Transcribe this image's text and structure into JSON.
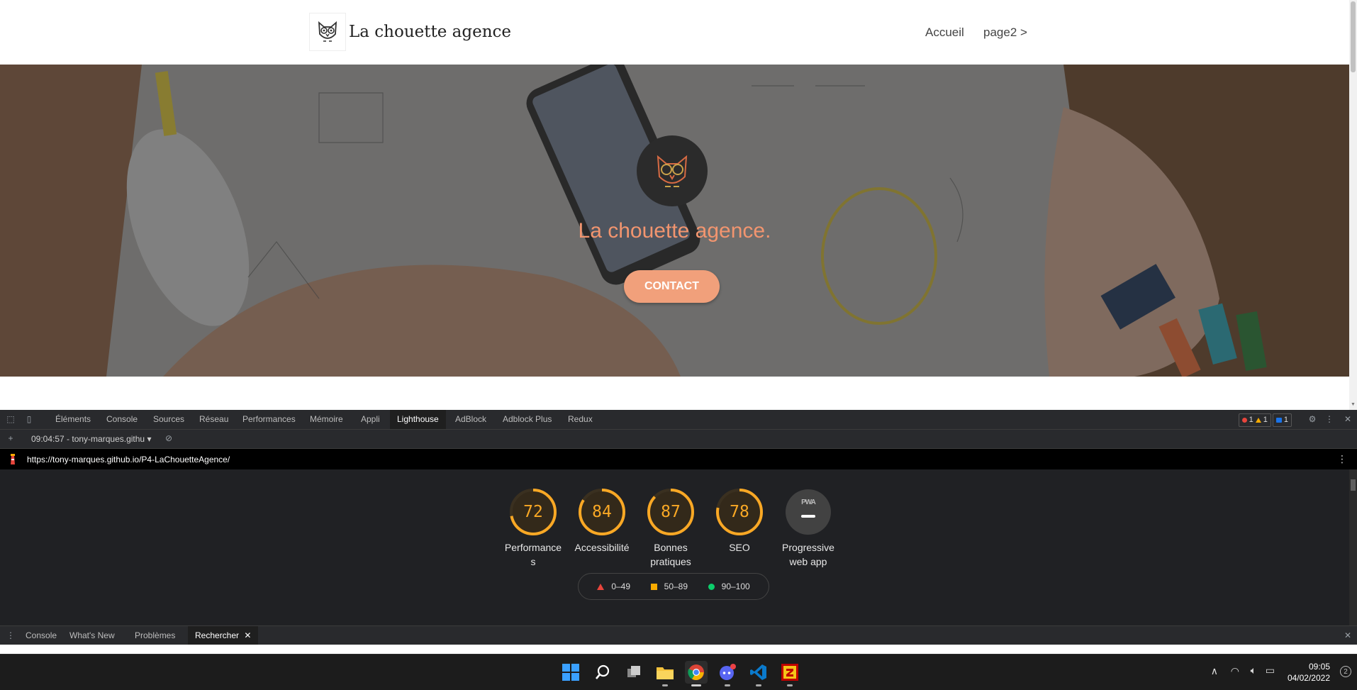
{
  "site": {
    "brand": "La chouette agence",
    "nav": {
      "home": "Accueil",
      "page2": "page2 >"
    },
    "hero": {
      "title": "La chouette agence.",
      "cta": "CONTACT"
    }
  },
  "devtools": {
    "tabs": [
      "Éléments",
      "Console",
      "Sources",
      "Réseau",
      "Performances",
      "Mémoire",
      "Appli",
      "Lighthouse",
      "AdBlock",
      "Adblock Plus",
      "Redux"
    ],
    "active_tab": "Lighthouse",
    "badges": {
      "errors": "1",
      "warnings": "1",
      "messages": "1"
    },
    "run_select": "09:04:57 - tony-marques.githu",
    "url": "https://tony-marques.github.io/P4-LaChouetteAgence/",
    "scores": [
      {
        "value": "72",
        "fraction": 0.72,
        "label": "Performance\ns"
      },
      {
        "value": "84",
        "fraction": 0.84,
        "label": "Accessibilité"
      },
      {
        "value": "87",
        "fraction": 0.87,
        "label": "Bonnes\npratiques"
      },
      {
        "value": "78",
        "fraction": 0.78,
        "label": "SEO"
      }
    ],
    "pwa": {
      "icon_text": "PWA",
      "label": "Progressive\nweb app"
    },
    "legend": {
      "fail": "0–49",
      "average": "50–89",
      "pass": "90–100"
    },
    "drawer_tabs": [
      "Console",
      "What's New",
      "Problèmes",
      "Rechercher"
    ],
    "drawer_active": "Rechercher",
    "colors": {
      "average": "#f9a825",
      "fail": "#e8453c",
      "pass": "#0cce6b",
      "hero_title": "#f2956f",
      "cta_bg": "#f1a07b"
    }
  },
  "taskbar": {
    "apps": [
      "windows-start-icon",
      "search-icon",
      "task-view-icon",
      "file-explorer-icon",
      "chrome-icon",
      "discord-icon",
      "vscode-icon",
      "filezilla-icon"
    ],
    "time": "09:05",
    "date": "04/02/2022",
    "notifications": "2"
  }
}
